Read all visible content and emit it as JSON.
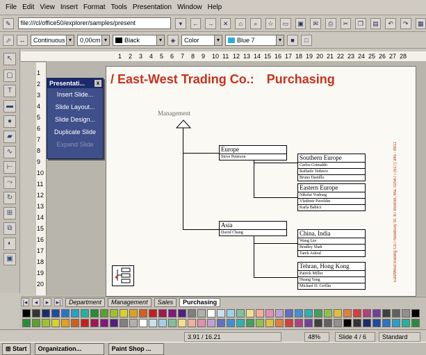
{
  "menu": [
    "File",
    "Edit",
    "View",
    "Insert",
    "Format",
    "Tools",
    "Presentation",
    "Window",
    "Help"
  ],
  "url": "file:///cl/office50/explorer/samples/present",
  "format_bar": {
    "line_style": "Continuous",
    "line_width": "0,00cm",
    "line_color": "Black",
    "fill_type": "Color",
    "fill_color": "Blue 7"
  },
  "popup": {
    "title": "Presentati...",
    "items": [
      "Insert Slide...",
      "Slide Layout...",
      "Slide Design...",
      "Duplicate Slide",
      "Expand Slide"
    ]
  },
  "slide": {
    "title": "/ East-West Trading Co.:",
    "subtitle": "Purchasing",
    "side_text": "EastWestTrading Co./ Newbury St. 87 Boston, Ma. 02567 / (617) 345 - 8911",
    "org": {
      "root": "Management",
      "europe": {
        "head": "Europe",
        "rows": [
          "Steve Peterson"
        ]
      },
      "southern_europe": {
        "head": "Southern Europe",
        "rows": [
          "Carlos Grimaldo",
          "Raffaele Tedesco",
          "Bruno Dastillo"
        ]
      },
      "eastern_europe": {
        "head": "Eastern Europe",
        "rows": [
          "Nikolai Vosburg",
          "Vladimir Paveldin",
          "Karla Babicz"
        ]
      },
      "asia": {
        "head": "Asia",
        "rows": [
          "David Chang"
        ]
      },
      "china_india": {
        "head": "China, India",
        "rows": [
          "Wang Lee",
          "Bradley Shah",
          "Tarek Ashraf"
        ]
      },
      "tehran_hk": {
        "head": "Tehran, Hong Kong",
        "rows": [
          "Patrick Miller",
          "Huang Yang",
          "Michael D. Griffin"
        ]
      }
    }
  },
  "tabs": [
    "Department",
    "Management",
    "Sales",
    "Purchasing"
  ],
  "status": {
    "position": "3.91 / 16.21",
    "zoom": "48%",
    "slide": "Slide 4 / 6",
    "layout": "Standard"
  },
  "taskbar": {
    "start": "Start",
    "apps": [
      "Organization...",
      "Paint Shop ..."
    ]
  },
  "palette_colors": [
    "#000000",
    "#333333",
    "#1a2a6a",
    "#1e4aa0",
    "#2a74c4",
    "#28a0c8",
    "#26b0a0",
    "#2a8a3c",
    "#5aa030",
    "#a0c030",
    "#d8d030",
    "#e0a020",
    "#d06020",
    "#c02020",
    "#a01850",
    "#801880",
    "#502080",
    "#808080",
    "#b0b0b0",
    "#ffffff",
    "#c8e0f0",
    "#a0d0e8",
    "#80c0a0",
    "#f0e090",
    "#f0b0a0",
    "#e090b0",
    "#c0a0d0",
    "#6070c0",
    "#4090d0",
    "#30b0b0",
    "#40a060",
    "#90c050",
    "#e0c040",
    "#e08040",
    "#d04040",
    "#b04080",
    "#7040a0",
    "#404040",
    "#606060",
    "#909090"
  ]
}
